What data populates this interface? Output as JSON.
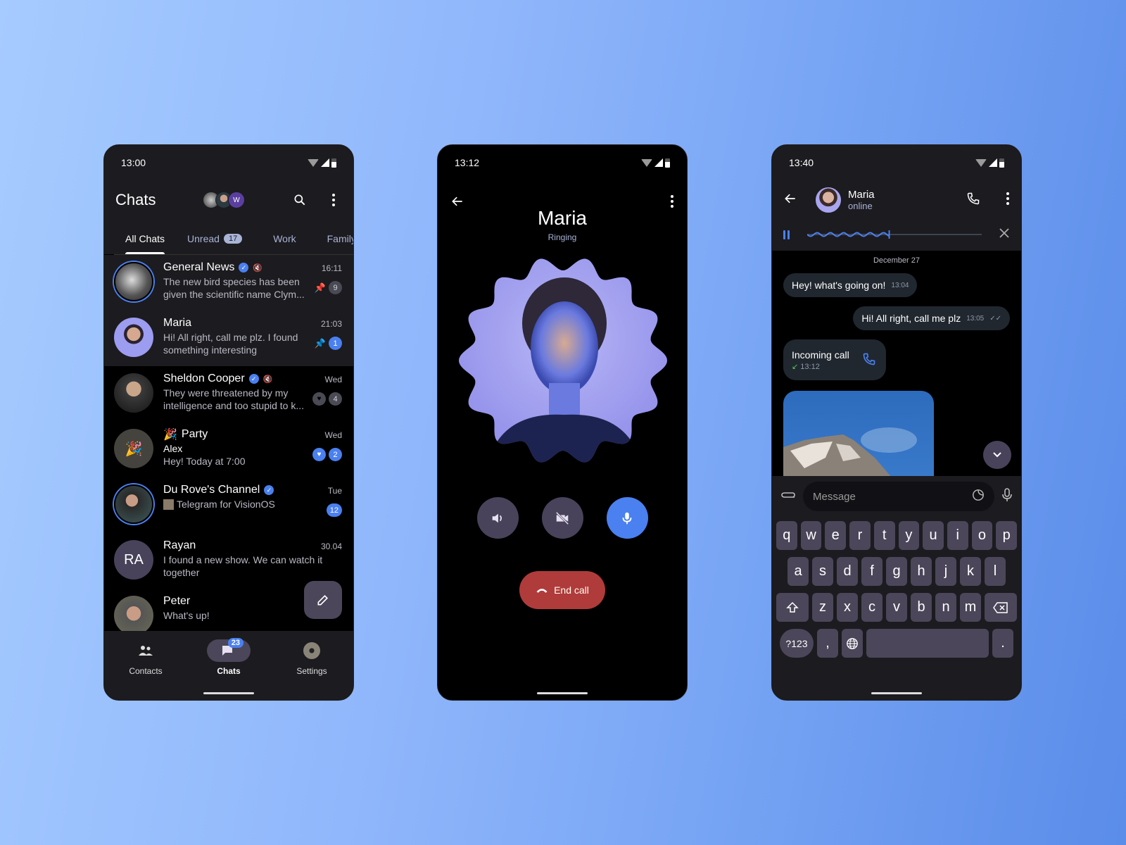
{
  "phone1": {
    "status_time": "13:00",
    "title": "Chats",
    "story_initial": "W",
    "tabs": [
      {
        "label": "All Chats",
        "active": true
      },
      {
        "label": "Unread",
        "badge": "17"
      },
      {
        "label": "Work"
      },
      {
        "label": "Family"
      }
    ],
    "chats": [
      {
        "name": "General News",
        "verified": true,
        "muted": true,
        "time": "16:11",
        "preview": "The new bird species has been given the scientific name Clym...",
        "pinned": true,
        "count": "9",
        "count_style": "grey"
      },
      {
        "name": "Maria",
        "verified": false,
        "time": "21:03",
        "preview": "Hi! All right, call me plz. I found something interesting",
        "pinned": true,
        "count": "1",
        "count_style": "blue"
      },
      {
        "name": "Sheldon Cooper",
        "verified": true,
        "muted": true,
        "time": "Wed",
        "preview": "They were threatened by my intelligence and too stupid to k...",
        "reaction": "heart",
        "count": "4",
        "count_style": "grey"
      },
      {
        "name": "Party",
        "emoji": "🎉",
        "time": "Wed",
        "sender": "Alex",
        "preview": "Hey! Today at 7:00",
        "reaction": "heart",
        "count": "2",
        "count_style": "blue"
      },
      {
        "name": "Du Rove's Channel",
        "verified": true,
        "time": "Tue",
        "preview": "Telegram for VisionOS",
        "count": "12",
        "count_style": "blue"
      },
      {
        "name": "Rayan",
        "initials": "RA",
        "time": "30.04",
        "preview": "I found a new show. We can watch it together"
      },
      {
        "name": "Peter",
        "preview": "What's up!"
      }
    ],
    "nav": [
      {
        "label": "Contacts",
        "icon": "contacts-icon"
      },
      {
        "label": "Chats",
        "icon": "chats-icon",
        "badge": "23",
        "active": true
      },
      {
        "label": "Settings",
        "icon": "settings-avatar"
      }
    ]
  },
  "phone2": {
    "status_time": "13:12",
    "caller_name": "Maria",
    "call_status": "Ringing",
    "controls": [
      "speaker-icon",
      "video-off-icon",
      "microphone-icon"
    ],
    "end_call_label": "End call"
  },
  "phone3": {
    "status_time": "13:40",
    "contact_name": "Maria",
    "contact_status": "online",
    "voice_progress": 0.47,
    "date_separator": "December 27",
    "messages": [
      {
        "text": "Hey! what's going on!",
        "time": "13:04",
        "direction": "in"
      },
      {
        "text": "Hi! All right, call me plz",
        "time": "13:05",
        "direction": "out",
        "read": true
      },
      {
        "text": "Incoming call",
        "time": "13:12",
        "direction": "in",
        "type": "call"
      }
    ],
    "input_placeholder": "Message",
    "keyboard": {
      "row1": [
        "q",
        "w",
        "e",
        "r",
        "t",
        "y",
        "u",
        "i",
        "o",
        "p"
      ],
      "row2": [
        "a",
        "s",
        "d",
        "f",
        "g",
        "h",
        "j",
        "k",
        "l"
      ],
      "row3": [
        "z",
        "x",
        "c",
        "v",
        "b",
        "n",
        "m"
      ],
      "symbols_label": "?123",
      "comma": ",",
      "period": "."
    }
  },
  "colors": {
    "accent": "#4a80ef",
    "surface": "#1c1b1f",
    "end_call": "#b03b3b",
    "key": "#4b4659"
  }
}
